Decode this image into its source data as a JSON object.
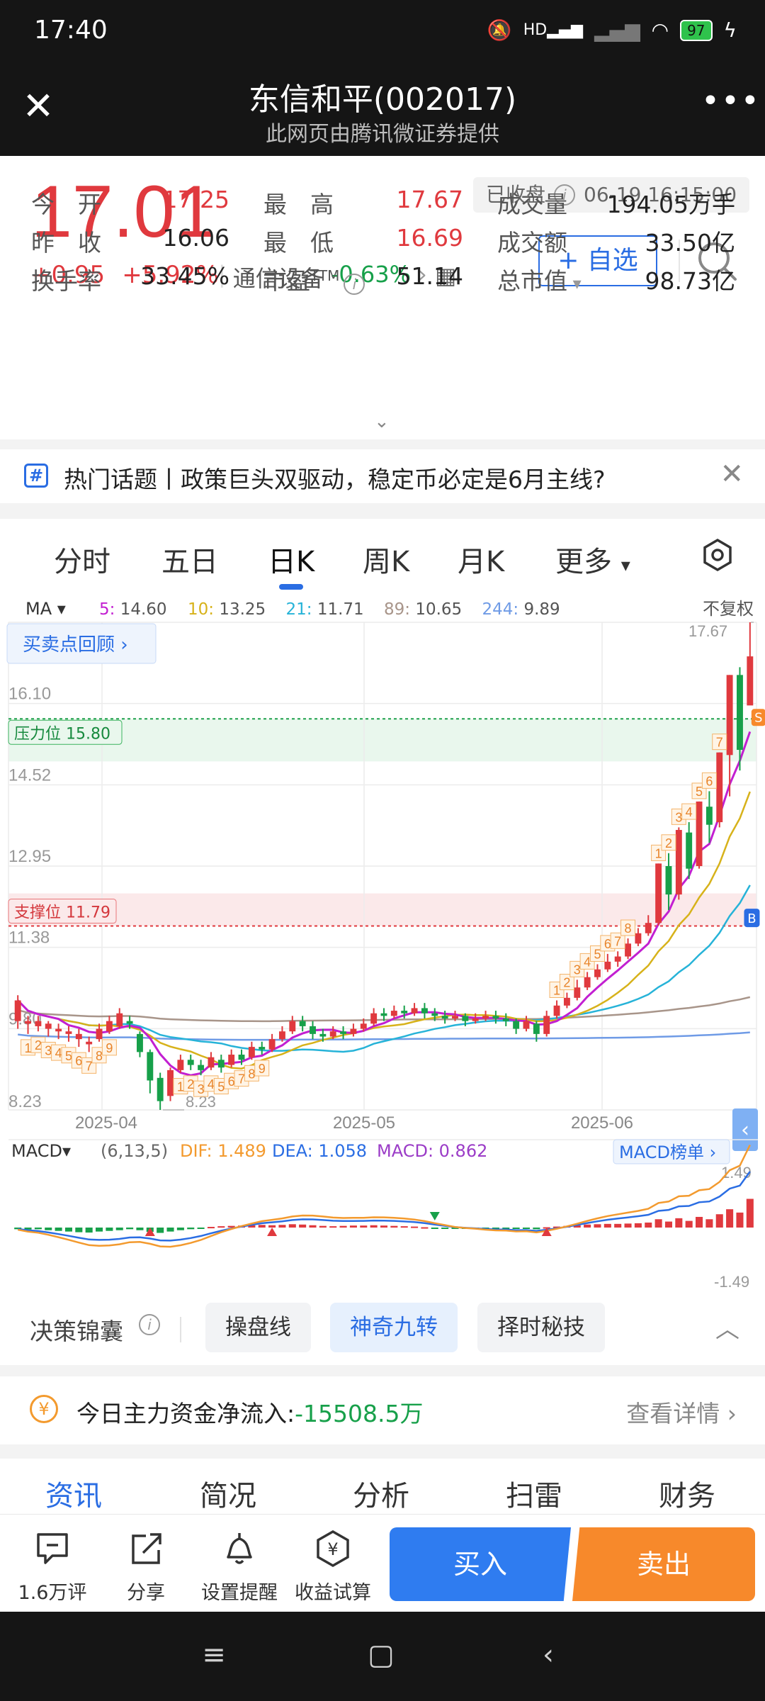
{
  "status": {
    "time": "17:40",
    "battery": "97",
    "hd": "HD"
  },
  "titlebar": {
    "title": "东信和平(002017)",
    "subtitle": "此网页由腾讯微证券提供"
  },
  "quote": {
    "price": "17.01",
    "change": "+0.95",
    "change_pct": "+5.92%",
    "industry_name": "通信设备",
    "industry_pct": "-0.63%",
    "market_status": "已收盘",
    "timestamp": "06-19 16:15:00",
    "fav_label": "+ 自选",
    "stats": [
      {
        "k": "今　开",
        "v": "17.25",
        "color": "red"
      },
      {
        "k": "最　高",
        "v": "17.67",
        "color": "red"
      },
      {
        "k": "成交量",
        "v": "194.05万手",
        "color": "dark"
      },
      {
        "k": "昨　收",
        "v": "16.06",
        "color": "dark"
      },
      {
        "k": "最　低",
        "v": "16.69",
        "color": "red"
      },
      {
        "k": "成交额",
        "v": "33.50亿",
        "color": "dark"
      },
      {
        "k": "换手率",
        "v": "33.45%",
        "color": "dark"
      },
      {
        "k": "市盈",
        "v": "51.14",
        "color": "dark"
      },
      {
        "k": "总市值",
        "v": "98.73亿",
        "color": "dark"
      }
    ],
    "pe_sup": "TTM"
  },
  "topic": {
    "text": "热门话题丨政策巨头双驱动，稳定币必定是6月主线?"
  },
  "periods": [
    "分时",
    "五日",
    "日K",
    "周K",
    "月K",
    "更多"
  ],
  "periods_active": "日K",
  "chart_data": {
    "type": "candlestick",
    "ma_label": "MA",
    "ma": [
      {
        "name": "5",
        "value": "14.60",
        "color": "#c21fd1"
      },
      {
        "name": "10",
        "value": "13.25",
        "color": "#d7b21a"
      },
      {
        "name": "21",
        "value": "11.71",
        "color": "#26b3d8"
      },
      {
        "name": "89",
        "value": "10.65",
        "color": "#a8958a"
      },
      {
        "name": "244",
        "value": "9.89",
        "color": "#6f9be6"
      }
    ],
    "adjust_label": "不复权",
    "review_label": "买卖点回顾",
    "y_ticks": [
      "16.10",
      "14.52",
      "12.95",
      "11.38",
      "9.80",
      "8.23"
    ],
    "ylim": [
      8.23,
      17.67
    ],
    "high_label": "17.67",
    "low_label": "8.23",
    "resistance": {
      "label": "压力位 15.80",
      "value": 15.8
    },
    "support": {
      "label": "支撑位 11.79",
      "value": 11.79
    },
    "x_labels": [
      "2025-04",
      "2025-05",
      "2025-06"
    ],
    "candles": [
      [
        9.95,
        10.35,
        9.8,
        10.45
      ],
      [
        9.9,
        9.95,
        9.7,
        10.05
      ],
      [
        9.85,
        9.95,
        9.75,
        10.05
      ],
      [
        9.8,
        9.9,
        9.65,
        9.95
      ],
      [
        9.75,
        9.8,
        9.6,
        9.9
      ],
      [
        9.7,
        9.75,
        9.55,
        9.85
      ],
      [
        9.6,
        9.7,
        9.45,
        9.8
      ],
      [
        9.5,
        9.55,
        9.35,
        9.65
      ],
      [
        9.6,
        9.8,
        9.55,
        9.9
      ],
      [
        9.75,
        9.95,
        9.7,
        10.05
      ],
      [
        9.85,
        10.1,
        9.8,
        10.2
      ],
      [
        9.95,
        9.9,
        9.8,
        10.05
      ],
      [
        9.7,
        9.35,
        9.25,
        9.75
      ],
      [
        9.35,
        8.8,
        8.55,
        9.4
      ],
      [
        8.85,
        8.4,
        8.23,
        8.95
      ],
      [
        8.5,
        9.0,
        8.4,
        9.05
      ],
      [
        9.0,
        9.2,
        8.95,
        9.3
      ],
      [
        9.2,
        9.1,
        9.0,
        9.3
      ],
      [
        9.1,
        9.0,
        8.9,
        9.2
      ],
      [
        9.05,
        9.25,
        9.0,
        9.35
      ],
      [
        9.2,
        9.05,
        8.95,
        9.3
      ],
      [
        9.1,
        9.3,
        9.05,
        9.4
      ],
      [
        9.3,
        9.2,
        9.1,
        9.4
      ],
      [
        9.25,
        9.45,
        9.2,
        9.55
      ],
      [
        9.45,
        9.4,
        9.3,
        9.55
      ],
      [
        9.4,
        9.6,
        9.35,
        9.7
      ],
      [
        9.6,
        9.75,
        9.55,
        9.85
      ],
      [
        9.75,
        9.95,
        9.7,
        10.05
      ],
      [
        9.95,
        9.85,
        9.75,
        10.05
      ],
      [
        9.85,
        9.7,
        9.6,
        9.95
      ],
      [
        9.7,
        9.65,
        9.55,
        9.8
      ],
      [
        9.65,
        9.75,
        9.6,
        9.85
      ],
      [
        9.75,
        9.7,
        9.6,
        9.85
      ],
      [
        9.7,
        9.8,
        9.65,
        9.9
      ],
      [
        9.8,
        9.9,
        9.75,
        10.0
      ],
      [
        9.9,
        10.1,
        9.85,
        10.2
      ],
      [
        10.1,
        10.05,
        9.95,
        10.2
      ],
      [
        10.05,
        10.15,
        10.0,
        10.25
      ],
      [
        10.15,
        10.1,
        10.0,
        10.25
      ],
      [
        10.1,
        10.2,
        10.05,
        10.3
      ],
      [
        10.2,
        10.1,
        10.0,
        10.3
      ],
      [
        10.1,
        10.05,
        9.95,
        10.2
      ],
      [
        10.05,
        10.0,
        9.9,
        10.15
      ],
      [
        10.0,
        10.05,
        9.95,
        10.15
      ],
      [
        10.05,
        9.95,
        9.85,
        10.1
      ],
      [
        9.95,
        10.0,
        9.9,
        10.1
      ],
      [
        10.0,
        10.05,
        9.95,
        10.15
      ],
      [
        10.05,
        10.0,
        9.9,
        10.15
      ],
      [
        10.0,
        9.95,
        9.85,
        10.1
      ],
      [
        9.95,
        9.8,
        9.7,
        10.0
      ],
      [
        9.8,
        9.95,
        9.75,
        10.05
      ],
      [
        9.9,
        9.7,
        9.55,
        9.95
      ],
      [
        9.7,
        10.05,
        9.65,
        10.15
      ],
      [
        10.05,
        10.25,
        10.0,
        10.35
      ],
      [
        10.25,
        10.4,
        10.2,
        10.5
      ],
      [
        10.4,
        10.6,
        10.35,
        10.75
      ],
      [
        10.6,
        10.8,
        10.55,
        10.9
      ],
      [
        10.8,
        10.95,
        10.75,
        11.05
      ],
      [
        10.95,
        11.1,
        10.9,
        11.25
      ],
      [
        11.1,
        11.2,
        11.0,
        11.3
      ],
      [
        11.2,
        11.45,
        11.15,
        11.55
      ],
      [
        11.45,
        11.65,
        11.4,
        11.75
      ],
      [
        11.65,
        11.85,
        11.6,
        12.0
      ],
      [
        11.85,
        13.0,
        11.8,
        13.0
      ],
      [
        12.95,
        12.4,
        12.1,
        13.2
      ],
      [
        12.4,
        13.65,
        12.3,
        13.7
      ],
      [
        13.6,
        12.9,
        12.7,
        13.8
      ],
      [
        12.95,
        14.2,
        12.9,
        14.2
      ],
      [
        14.1,
        13.75,
        13.4,
        14.4
      ],
      [
        13.8,
        15.15,
        13.7,
        15.15
      ],
      [
        15.1,
        16.65,
        14.3,
        16.65
      ],
      [
        16.65,
        15.2,
        14.8,
        16.8
      ],
      [
        16.06,
        17.01,
        16.69,
        17.67
      ]
    ],
    "macd": {
      "label": "MACD",
      "params": "(6,13,5)",
      "dif": "DIF: 1.489",
      "dea": "DEA: 1.058",
      "macd": "MACD: 0.862",
      "rank_label": "MACD榜单",
      "top_tick": "1.49",
      "bottom_tick": "-1.49",
      "bars": [
        -0.05,
        -0.06,
        -0.05,
        -0.08,
        -0.1,
        -0.12,
        -0.14,
        -0.15,
        -0.12,
        -0.1,
        -0.08,
        -0.05,
        -0.08,
        -0.13,
        -0.16,
        -0.12,
        -0.08,
        -0.05,
        -0.02,
        0.02,
        0.04,
        0.05,
        0.06,
        0.07,
        0.08,
        0.07,
        0.08,
        0.1,
        0.09,
        0.07,
        0.05,
        0.04,
        0.05,
        0.06,
        0.06,
        0.07,
        0.06,
        0.05,
        0.04,
        0.03,
        0.01,
        -0.01,
        -0.02,
        -0.03,
        -0.02,
        -0.02,
        -0.03,
        -0.03,
        -0.02,
        -0.04,
        -0.02,
        -0.05,
        0.01,
        0.03,
        0.05,
        0.07,
        0.09,
        0.1,
        0.11,
        0.11,
        0.12,
        0.13,
        0.15,
        0.25,
        0.18,
        0.28,
        0.2,
        0.32,
        0.25,
        0.4,
        0.55,
        0.45,
        0.862
      ]
    },
    "nine_marks": [
      "1",
      "2",
      "3",
      "4",
      "5",
      "6",
      "7",
      "8",
      "9"
    ],
    "buy_mark": "B",
    "sell_mark": "S"
  },
  "decision": {
    "label": "决策锦囊",
    "chips": [
      "操盘线",
      "神奇九转",
      "择时秘技"
    ],
    "active": "神奇九转"
  },
  "flow": {
    "label": "今日主力资金净流入:",
    "value": "-15508.5万",
    "detail": "查看详情"
  },
  "info_tabs": [
    "资讯",
    "简况",
    "分析",
    "扫雷",
    "财务"
  ],
  "actions": [
    {
      "label": "1.6万评",
      "icon": "comment-icon"
    },
    {
      "label": "分享",
      "icon": "share-icon"
    },
    {
      "label": "设置提醒",
      "icon": "bell-icon"
    },
    {
      "label": "收益试算",
      "icon": "yen-calc-icon"
    }
  ],
  "buy_label": "买入",
  "sell_label": "卖出",
  "colors": {
    "up": "#e0393e",
    "down": "#17a04a",
    "accent": "#2a6de3",
    "sell": "#f7892b"
  }
}
